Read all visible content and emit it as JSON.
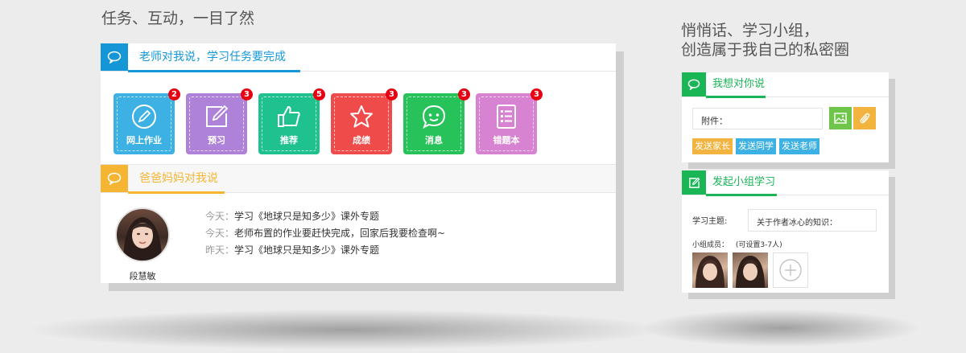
{
  "headings": {
    "left": "任务、互动，一目了然",
    "right_line1": "悄悄话、学习小组，",
    "right_line2": "创造属于我自己的私密圈"
  },
  "teacher_panel": {
    "title": "老师对我说，学习任务要完成",
    "tiles": [
      {
        "label": "网上作业",
        "badge": "2",
        "color": "#3db1e3",
        "icon": "pencil-circle-icon"
      },
      {
        "label": "预习",
        "badge": "3",
        "color": "#ad82d8",
        "icon": "edit-square-icon"
      },
      {
        "label": "推荐",
        "badge": "5",
        "color": "#1fc28f",
        "icon": "thumbs-up-icon"
      },
      {
        "label": "成绩",
        "badge": "3",
        "color": "#ef4b4b",
        "icon": "star-icon"
      },
      {
        "label": "消息",
        "badge": "3",
        "color": "#27c35a",
        "icon": "chat-bubble-icon"
      },
      {
        "label": "错题本",
        "badge": "3",
        "color": "#d883d1",
        "icon": "list-document-icon"
      }
    ]
  },
  "parents_panel": {
    "title": "爸爸妈妈对我说",
    "parent_name": "段慧敏",
    "messages": [
      {
        "when": "今天：",
        "text": "学习《地球只是知多少》课外专题"
      },
      {
        "when": "今天：",
        "text": "老师布置的作业要赶快完成，回家后我要检查啊~"
      },
      {
        "when": "昨天：",
        "text": "学习《地球只是知多少》课外专题"
      }
    ]
  },
  "whisper_panel": {
    "title": "我想对你说",
    "attachment_label": "附件：",
    "send_buttons": [
      {
        "label": "发送家长",
        "color": "#f2b33f"
      },
      {
        "label": "发送同学",
        "color": "#3db1e3"
      },
      {
        "label": "发送老师",
        "color": "#3db1e3"
      }
    ]
  },
  "group_panel": {
    "title": "发起小组学习",
    "topic_label": "学习主题:",
    "topic_value": "关于作者冰心的知识：",
    "members_label": "小组成员：",
    "members_hint": "(可设置3-7人)"
  },
  "colors": {
    "blue": "#1597d7",
    "yellow": "#f5b533",
    "green": "#1ab656"
  }
}
